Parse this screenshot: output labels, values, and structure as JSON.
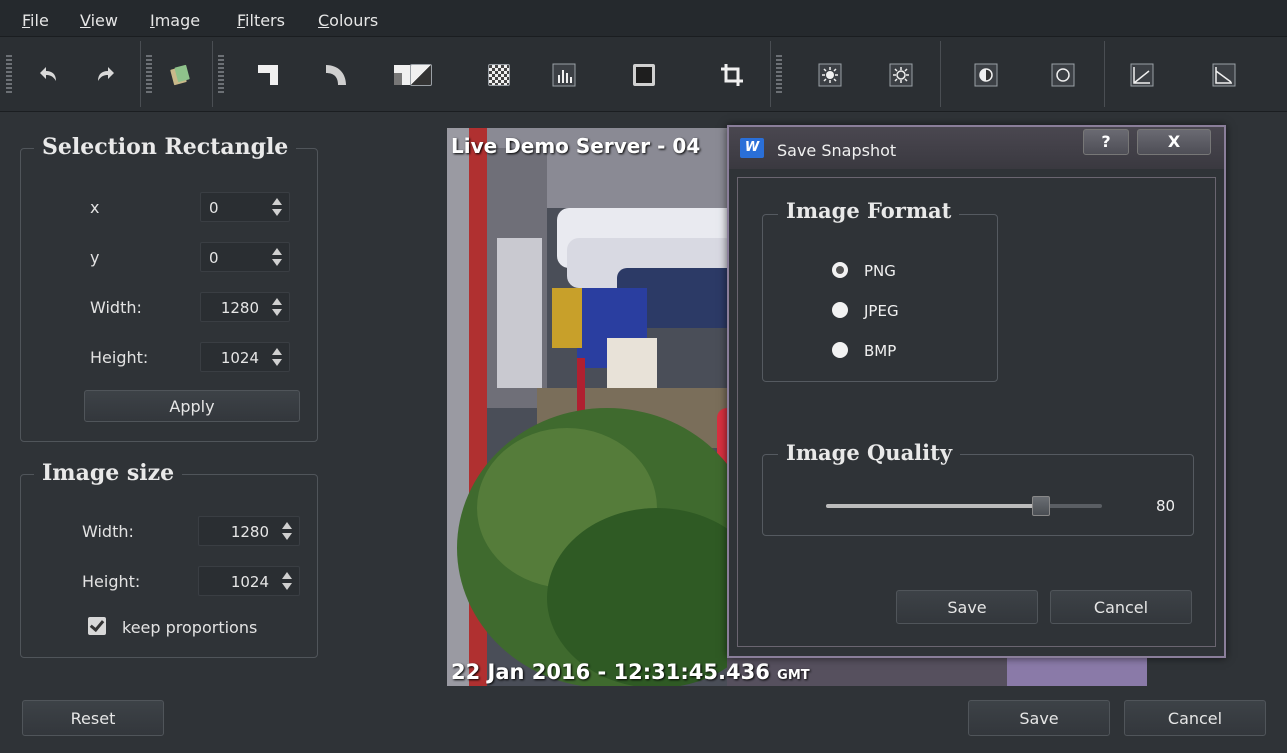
{
  "menu": {
    "file": {
      "underline": "F",
      "rest": "ile"
    },
    "view": {
      "underline": "V",
      "rest": "iew"
    },
    "image": {
      "underline": "I",
      "rest": "mage"
    },
    "filters": {
      "underline": "F",
      "rest": "ilters"
    },
    "colours": {
      "underline": "C",
      "rest": "olours"
    }
  },
  "toolbar": {
    "icons": [
      "undo-icon",
      "redo-icon",
      "paste-image-icon",
      "corner-icon",
      "curve-icon",
      "invert-icon",
      "half-tone-icon",
      "checkerboard-icon",
      "histogram-icon",
      "frame-icon",
      "crop-icon",
      "brightness-up-icon",
      "brightness-down-icon",
      "contrast-icon",
      "circle-icon",
      "gamma-up-icon",
      "gamma-down-icon"
    ]
  },
  "selection": {
    "title": "Selection Rectangle",
    "x_label": "x",
    "x_value": "0",
    "y_label": "y",
    "y_value": "0",
    "width_label": "Width:",
    "width_value": "1280",
    "height_label": "Height:",
    "height_value": "1024",
    "apply_label": "Apply"
  },
  "image_size": {
    "title": "Image size",
    "width_label": "Width:",
    "width_value": "1280",
    "height_label": "Height:",
    "height_value": "1024",
    "keep_label": "keep proportions",
    "keep_checked": true
  },
  "video": {
    "header": "Live Demo Server - 04",
    "timestamp": "22 Jan 2016 - 12:31:45.436",
    "tz": "GMT"
  },
  "dialog": {
    "title": "Save Snapshot",
    "help_label": "?",
    "close_label": "X",
    "format_title": "Image Format",
    "formats": [
      "PNG",
      "JPEG",
      "BMP"
    ],
    "selected_format": "PNG",
    "quality_title": "Image Quality",
    "quality_value": "80",
    "quality_fraction": 0.8,
    "save_label": "Save",
    "cancel_label": "Cancel"
  },
  "bottom": {
    "reset_label": "Reset",
    "save_label": "Save",
    "cancel_label": "Cancel"
  },
  "colors": {
    "accent": "#2a6fd8",
    "background": "#2f3337",
    "dialog_border": "#8a7e9a"
  }
}
